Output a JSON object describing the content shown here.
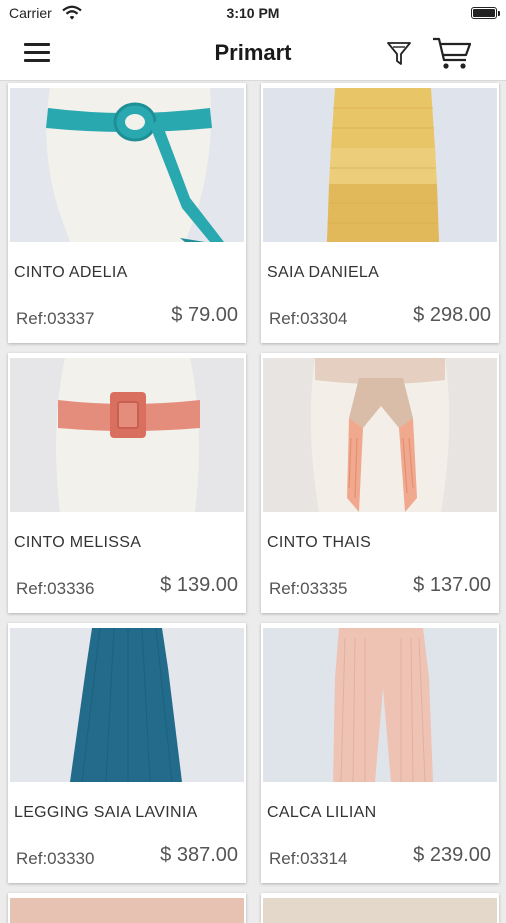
{
  "status": {
    "carrier": "Carrier",
    "time": "3:10 PM"
  },
  "nav": {
    "title": "Primart"
  },
  "products": [
    {
      "name": "CINTO ADELIA",
      "ref": "Ref:03337",
      "price": "$ 79.00"
    },
    {
      "name": "SAIA DANIELA",
      "ref": "Ref:03304",
      "price": "$ 298.00"
    },
    {
      "name": "CINTO MELISSA",
      "ref": "Ref:03336",
      "price": "$ 139.00"
    },
    {
      "name": "CINTO THAIS",
      "ref": "Ref:03335",
      "price": "$ 137.00"
    },
    {
      "name": "LEGGING SAIA LAVINIA",
      "ref": "Ref:03330",
      "price": "$ 387.00"
    },
    {
      "name": "CALCA LILIAN",
      "ref": "Ref:03314",
      "price": "$ 239.00"
    }
  ],
  "icons": {
    "menu": "hamburger-menu-icon",
    "filter": "filter-funnel-icon",
    "cart": "shopping-cart-icon",
    "wifi": "wifi-icon",
    "battery": "battery-icon"
  },
  "colors": {
    "background": "#ececec",
    "card": "#ffffff",
    "text": "#333333"
  }
}
